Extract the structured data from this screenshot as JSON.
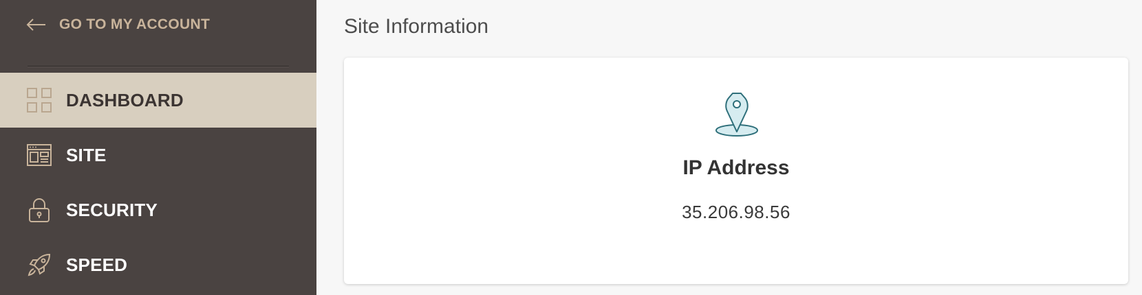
{
  "sidebar": {
    "back_link": {
      "label": "GO TO MY ACCOUNT",
      "icon": "arrow-left-icon"
    },
    "items": [
      {
        "label": "DASHBOARD",
        "icon": "grid-icon",
        "active": true
      },
      {
        "label": "SITE",
        "icon": "browser-window-icon",
        "active": false
      },
      {
        "label": "SECURITY",
        "icon": "lock-icon",
        "active": false
      },
      {
        "label": "SPEED",
        "icon": "rocket-icon",
        "active": false
      }
    ]
  },
  "main": {
    "title": "Site Information",
    "card": {
      "icon": "map-pin-icon",
      "heading": "IP Address",
      "value": "35.206.98.56"
    }
  },
  "colors": {
    "sidebar_bg": "#4a4341",
    "sidebar_active_bg": "#d8cfbf",
    "accent_tan": "#c9b49b",
    "pin_fill": "#d6ecf0",
    "pin_stroke": "#2e6f7a"
  }
}
